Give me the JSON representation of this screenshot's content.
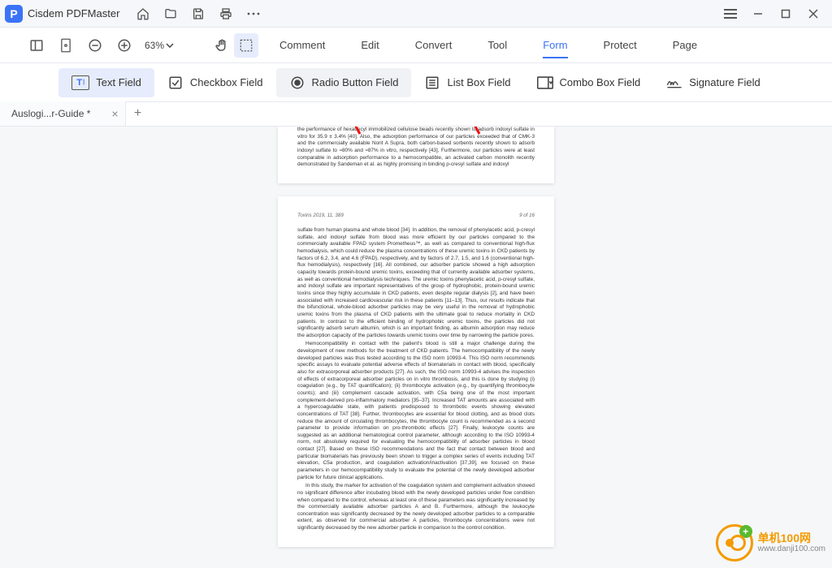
{
  "titlebar": {
    "app_name": "Cisdem PDFMaster"
  },
  "toolbar": {
    "zoom_level": "63%"
  },
  "menu": {
    "items": [
      "Comment",
      "Edit",
      "Convert",
      "Tool",
      "Form",
      "Protect",
      "Page"
    ],
    "active_index": 4
  },
  "formbar": {
    "items": [
      {
        "label": "Text Field"
      },
      {
        "label": "Checkbox Field"
      },
      {
        "label": "Radio Button Field"
      },
      {
        "label": "List Box Field"
      },
      {
        "label": "Combo Box Field"
      },
      {
        "label": "Signature Field"
      }
    ],
    "selected_index": 0,
    "hover_index": 2
  },
  "tabs": {
    "open": [
      {
        "label": "Auslogi...r-Guide *"
      }
    ]
  },
  "document": {
    "page1_body": "the performance of hexadecyl immobilized cellulose beads recently shown to adsorb indoxyl sulfate in vitro for 35.9 ± 3.4% [40]. Also, the adsorption performance of our particles exceeded that of CMK-3 and the commercially available Norit A Supra, both carbon-based sorbents recently shown to adsorb indoxyl sulfate to ≈80% and ≈87% in vitro, respectively [43]. Furthermore, our particles were at least comparable in adsorption performance to a hemocompatible, an activated carbon monolith recently demonstrated by Sandeman et al. as highly promising in binding p-cresyl sulfate and indoxyl",
    "page2_header_left": "Toxins 2019, 11, 389",
    "page2_header_right": "9 of 16",
    "page2_body_a": "sulfate from human plasma and whole blood [34]. In addition, the removal of phenylacetic acid, p-cresyl sulfate, and indoxyl sulfate from blood was more efficient by our particles compared to the commercially available FPAD system Prometheus™, as well as compared to conventional high-flux hemodialysis, which could reduce the plasma concentrations of these uremic toxins in CKD patients by factors of 6.2, 3.4, and 4.6 (FPAD), respectively, and by factors of 2.7, 1.5, and 1.6 (conventional high-flux hemodialysis), respectively [16]. All combined, our adsorber particle showed a high adsorption capacity towards protein-bound uremic toxins, exceeding that of currently available adsorber systems, as well as conventional hemodialysis techniques. The uremic toxins phenylacetic acid, p-cresyl sulfate, and indoxyl sulfate are important representatives of the group of hydrophobic, protein-bound uremic toxins since they highly accumulate in CKD patients, even despite regular dialysis [2], and have been associated with increased cardiovascular risk in these patients [11–13]. Thus, our results indicate that the bifunctional, whole-blood adsorber particles may be very useful in the removal of hydrophobic uremic toxins from the plasma of CKD patients with the ultimate goal to reduce mortality in CKD patients. In contrast to the efficient binding of hydrophobic uremic toxins, the particles did not significantly adsorb serum albumin, which is an important finding, as albumin adsorption may reduce the adsorption capacity of the particles towards uremic toxins over time by narrowing the particle pores.",
    "page2_body_b": "Hemocompatibility in contact with the patient's blood is still a major challenge during the development of new methods for the treatment of CKD patients. The hemocompatibility of the newly developed particles was thus tested according to the ISO norm 10993-4. This ISO norm recommends specific assays to evaluate potential adverse effects of biomaterials in contact with blood, specifically also for extracorporeal adsorber products [27]. As such, the ISO norm 10993-4 advises the inspection of effects of extracorporeal adsorber particles on in vitro thrombosis, and this is done by studying (i) coagulation (e.g., by TAT quantification); (ii) thrombocyte activation (e.g., by quantifying thrombocyte counts); and (iii) complement cascade activation, with C5a being one of the most important complement-derived pro-inflammatory mediators [35–37]. Increased TAT amounts are associated with a hypercoagulable state, with patients predisposed to thrombotic events showing elevated concentrations of TAT [38]. Further, thrombocytes are essential for blood clotting, and as blood clots reduce the amount of circulating thrombocytes, the thrombocyte count is recommended as a second parameter to provide information on pro-thrombotic effects [27]. Finally, leukocyte counts are suggested as an additional hematological control parameter, although according to the ISO 10993-4 norm, not absolutely required for evaluating the hemocompatibility of adsorber particles in blood contact [27]. Based on these ISO recommendations and the fact that contact between blood and particular biomaterials has previously been shown to trigger a complex series of events including TAT elevation, C5a production, and coagulation activation/inactivation [37,39], we focused on these parameters in our hemocompatibility study to evaluate the potential of the newly developed adsorber particle for future clinical applications.",
    "page2_body_c": "In this study, the marker for activation of the coagulation system and complement activation showed no significant difference after incubating blood with the newly developed particles under flow condition when compared to the control, whereas at least one of these parameters was significantly increased by the commercially available adsorber particles A and B. Furthermore, although the leukocyte concentration was significantly decreased by the newly developed adsorber particles to a comparable extent, as observed for commercial adsorber A particles, thrombocyte concentrations were not significantly decreased by the new adsorber particle in comparison to the control condition."
  },
  "watermark": {
    "name": "单机100网",
    "url": "www.danji100.com"
  }
}
